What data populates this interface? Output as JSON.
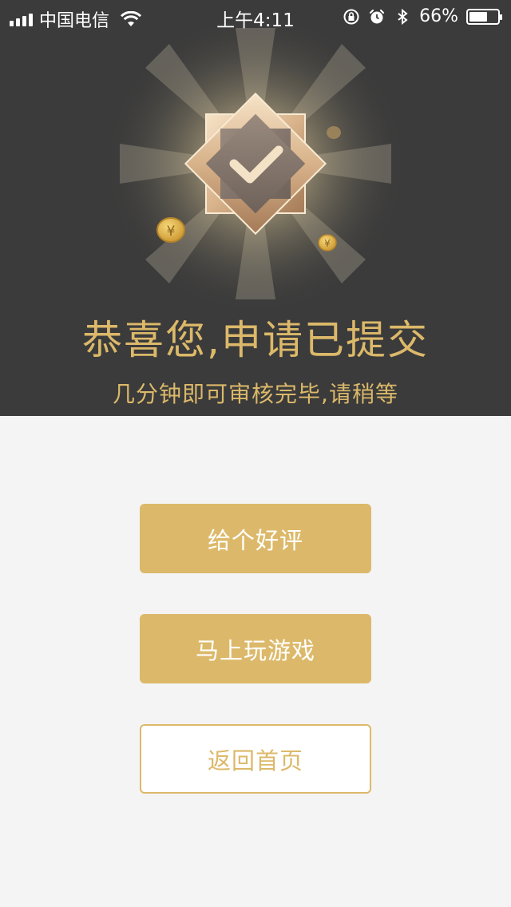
{
  "status_bar": {
    "carrier": "中国电信",
    "time": "上午4:11",
    "battery_percent": "66%",
    "battery_level": 0.66,
    "icons": [
      "signal-icon",
      "wifi-icon",
      "rotation-lock-icon",
      "alarm-icon",
      "bluetooth-icon",
      "battery-icon"
    ]
  },
  "hero": {
    "badge_icon": "checkmark-badge-icon",
    "coin_icon": "yuan-coin-icon",
    "title": "恭喜您,申请已提交",
    "subtitle": "几分钟即可审核完毕,请稍等"
  },
  "actions": {
    "rate_label": "给个好评",
    "play_label": "马上玩游戏",
    "home_label": "返回首页"
  },
  "colors": {
    "accent_gold": "#dcb96a",
    "hero_background": "#3b3b3b",
    "page_background": "#f4f4f4"
  }
}
